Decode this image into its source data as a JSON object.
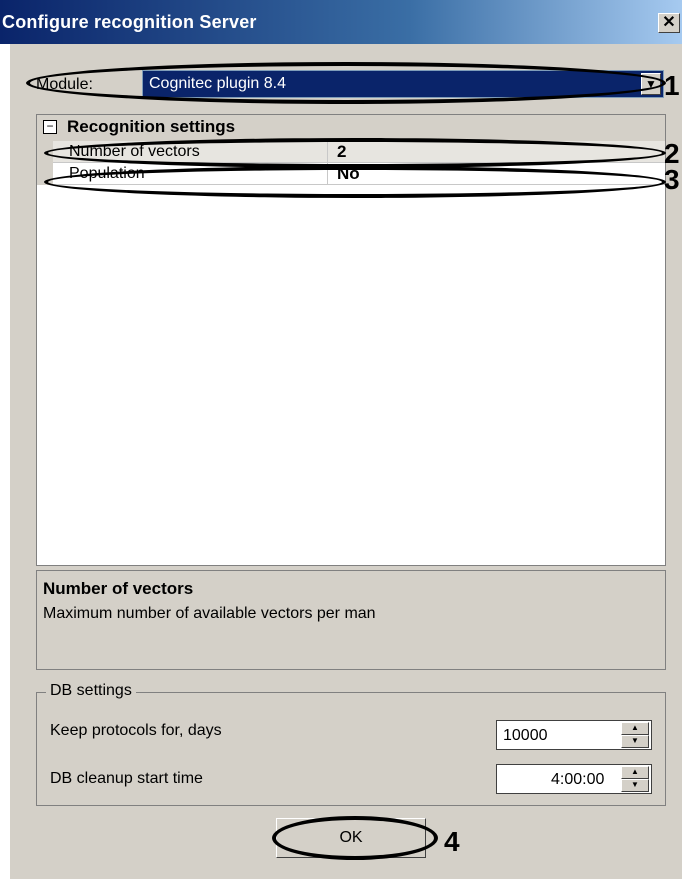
{
  "window": {
    "title": "Configure recognition Server",
    "close_glyph": "✕"
  },
  "module": {
    "label": "Module:",
    "selected": "Cognitec plugin 8.4",
    "arrow_icon": "▼"
  },
  "properties": {
    "group_icon": "⊟",
    "group_title": "Recognition settings",
    "rows": [
      {
        "name": "Number of vectors",
        "value": "2"
      },
      {
        "name": "Population",
        "value": "No"
      }
    ]
  },
  "description": {
    "title": "Number of vectors",
    "text": "Maximum number of available vectors per man"
  },
  "db_settings": {
    "legend": "DB settings",
    "keep_protocols": {
      "label": "Keep protocols for, days",
      "value": "10000"
    },
    "cleanup_time": {
      "label": "DB cleanup start time",
      "value": "4:00:00"
    }
  },
  "buttons": {
    "ok": "OK"
  },
  "callouts": [
    "1",
    "2",
    "3",
    "4"
  ]
}
